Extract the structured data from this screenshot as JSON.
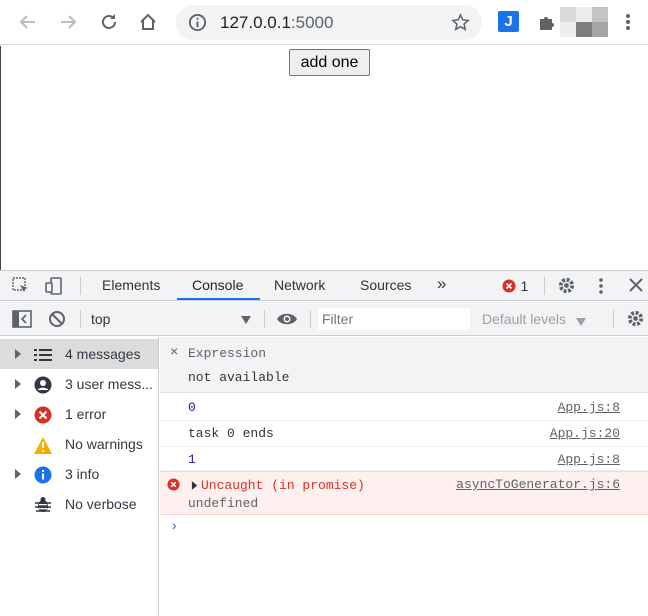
{
  "browser": {
    "url_host": "127.0.0.1",
    "url_port": ":5000",
    "extension_letter": "J"
  },
  "page": {
    "add_button_label": "add one"
  },
  "devtools": {
    "tabs": [
      "Elements",
      "Console",
      "Network",
      "Sources"
    ],
    "more_tabs": "»",
    "error_count": "1",
    "context": "top",
    "filter_placeholder": "Filter",
    "levels": "Default levels",
    "sidebar": [
      {
        "label": "4 messages",
        "icon": "list-icon",
        "selected": true
      },
      {
        "label": "3 user mess...",
        "icon": "user-icon",
        "selected": false
      },
      {
        "label": "1 error",
        "icon": "error-icon",
        "selected": false
      },
      {
        "label": "No warnings",
        "icon": "warning-icon",
        "selected": false
      },
      {
        "label": "3 info",
        "icon": "info-icon",
        "selected": false
      },
      {
        "label": "No verbose",
        "icon": "bug-icon",
        "selected": false
      }
    ],
    "expression": {
      "label": "Expression",
      "value": "not available"
    },
    "messages": [
      {
        "text": "0",
        "source": "App.js:8"
      },
      {
        "text": "task 0 ends",
        "source": "App.js:20"
      },
      {
        "text": "1",
        "source": "App.js:8"
      }
    ],
    "error": {
      "text": "Uncaught (in promise)",
      "detail": "undefined",
      "source": "asyncToGenerator.js:6"
    },
    "prompt": "›"
  },
  "colors": {
    "accent": "#1a73e8",
    "error": "#d93025",
    "warning": "#f9ab00"
  }
}
